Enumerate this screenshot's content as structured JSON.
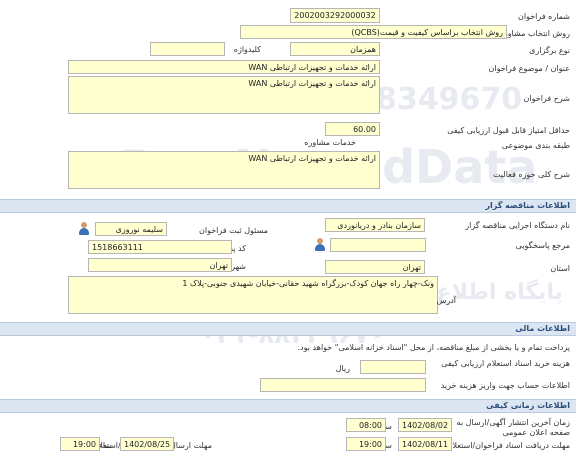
{
  "tender": {
    "number_label": "شماره فراخوان",
    "number_value": "2002003292000032",
    "method_label": "روش انتخاب مشاور",
    "method_value": "روش انتخاب براساس کیفیت و قیمت(QCBS)",
    "type_label": "نوع برگزاری",
    "type_value": "همزمان",
    "keyword_label": "کلیدواژه",
    "keyword_value": "",
    "subject_label": "عنوان / موضوع فراخوان",
    "subject_value": "ارائه خدمات و تجهیزات ارتباطی WAN",
    "description_label": "شرح فراخوان",
    "description_value": "ارائه خدمات و تجهیزات ارتباطی WAN",
    "min_score_label": "حداقل امتیاز قابل قبول ارزیابی کیفی",
    "min_score_value": "60.00",
    "category_label": "طبقه بندی موضوعی",
    "category_value": "خدمات مشاوره",
    "scope_label": "شرح کلی حوزه فعالیت",
    "scope_value": "ارائه خدمات و تجهیزات ارتباطی WAN"
  },
  "organizer": {
    "section_title": "اطلاعات مناقصه گزار",
    "executor_label": "نام دستگاه اجرایی مناقصه گزار",
    "executor_value": "سازمان بنادر و دریانوردی",
    "officer_label": "مسئول ثبت فراخوان",
    "officer_value": "سلیمه نوروزی",
    "reference_label": "مرجع پاسخگویی",
    "reference_value": "",
    "postal_label": "کد پستی",
    "postal_value": "1518663111",
    "province_label": "استان",
    "province_value": "تهران",
    "city_label": "شهر",
    "city_value": "تهران",
    "address_label": "آدرس",
    "address_value": "ونک-چهار راه جهان کودک-بزرگراه شهید حقانی-خیابان شهیدی جنوبی-پلاک 1"
  },
  "financial": {
    "section_title": "اطلاعات مالی",
    "guarantee_note": "پرداخت تمام و یا بخشی از مبلغ مناقصه، از محل \"اسناد خزانه اسلامی\" خواهد بود.",
    "fee_label": "هزینه خرید اسناد استعلام ارزیابی کیفی",
    "fee_value": "",
    "fee_unit": "ریال",
    "account_label": "اطلاعات حساب جهت واریز هزینه خرید",
    "account_value": ""
  },
  "timing": {
    "section_title": "اطلاعات زمانی کیفی",
    "publish_label": "زمان آخرین انتشار آگهی/ارسال به صفحه اعلان عمومی",
    "publish_date": "1402/08/02",
    "publish_time_label": "ساعت",
    "publish_time": "08:00",
    "receive_label": "مهلت دریافت اسناد فراخوان/استعلام",
    "receive_date": "1402/08/11",
    "receive_time_label": "ساعت",
    "receive_time": "19:00",
    "response_label": "مهلت ارسال پاسخ فراخوان/استعلام",
    "response_date": "1402/08/25",
    "response_time_label": "ساعت",
    "response_time": "19:00"
  },
  "watermark": {
    "line1": "ParsNamadData",
    "line2": "پایگاه اطلاع رسانی مناقصه و مزایده",
    "line3": "۰۲۱-۸۸۳۴۹۶۷۰",
    "line4": "021-88349670"
  },
  "colors": {
    "field_bg": "#ffffd0",
    "section_bg": "#dbe6f2",
    "section_text": "#2e4f7a"
  },
  "icons": [
    "person-icon"
  ]
}
